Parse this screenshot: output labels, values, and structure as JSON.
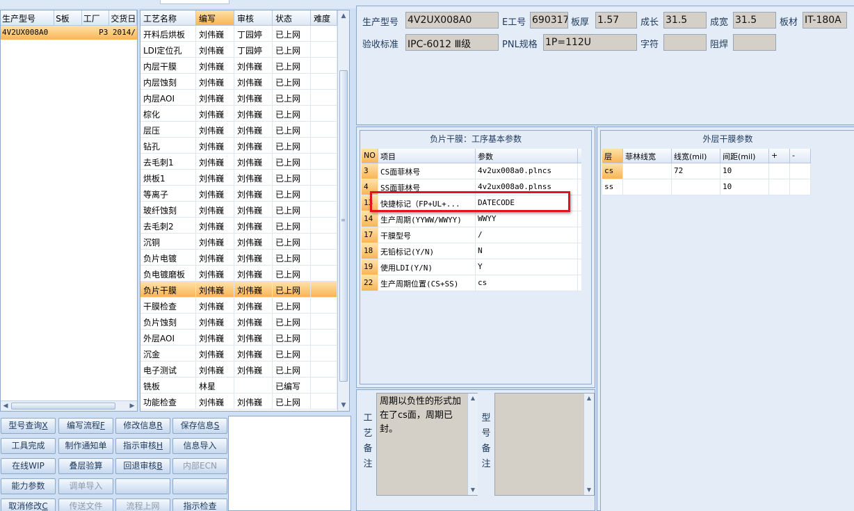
{
  "model_list": {
    "columns": [
      "生产型号",
      "S板",
      "工厂",
      "交货日"
    ],
    "selected_row": {
      "model": "4V2UX008A0",
      "s_board": "",
      "factory": "P3",
      "delivery": "2014/"
    }
  },
  "process_list": {
    "columns": [
      "工艺名称",
      "编写",
      "审核",
      "状态",
      "难度"
    ],
    "rows": [
      {
        "name": "开料后烘板",
        "writer": "刘伟巍",
        "reviewer": "丁园婷",
        "status": "已上网"
      },
      {
        "name": "LDI定位孔",
        "writer": "刘伟巍",
        "reviewer": "丁园婷",
        "status": "已上网"
      },
      {
        "name": "内层干膜",
        "writer": "刘伟巍",
        "reviewer": "刘伟巍",
        "status": "已上网"
      },
      {
        "name": "内层蚀刻",
        "writer": "刘伟巍",
        "reviewer": "刘伟巍",
        "status": "已上网"
      },
      {
        "name": "内层AOI",
        "writer": "刘伟巍",
        "reviewer": "刘伟巍",
        "status": "已上网"
      },
      {
        "name": "棕化",
        "writer": "刘伟巍",
        "reviewer": "刘伟巍",
        "status": "已上网"
      },
      {
        "name": "层压",
        "writer": "刘伟巍",
        "reviewer": "刘伟巍",
        "status": "已上网"
      },
      {
        "name": "钻孔",
        "writer": "刘伟巍",
        "reviewer": "刘伟巍",
        "status": "已上网"
      },
      {
        "name": "去毛刺1",
        "writer": "刘伟巍",
        "reviewer": "刘伟巍",
        "status": "已上网"
      },
      {
        "name": "烘板1",
        "writer": "刘伟巍",
        "reviewer": "刘伟巍",
        "status": "已上网"
      },
      {
        "name": "等离子",
        "writer": "刘伟巍",
        "reviewer": "刘伟巍",
        "status": "已上网"
      },
      {
        "name": "玻纤蚀刻",
        "writer": "刘伟巍",
        "reviewer": "刘伟巍",
        "status": "已上网"
      },
      {
        "name": "去毛刺2",
        "writer": "刘伟巍",
        "reviewer": "刘伟巍",
        "status": "已上网"
      },
      {
        "name": "沉铜",
        "writer": "刘伟巍",
        "reviewer": "刘伟巍",
        "status": "已上网"
      },
      {
        "name": "负片电镀",
        "writer": "刘伟巍",
        "reviewer": "刘伟巍",
        "status": "已上网"
      },
      {
        "name": "负电镀磨板",
        "writer": "刘伟巍",
        "reviewer": "刘伟巍",
        "status": "已上网"
      },
      {
        "name": "负片干膜",
        "writer": "刘伟巍",
        "reviewer": "刘伟巍",
        "status": "已上网"
      },
      {
        "name": "干膜检查",
        "writer": "刘伟巍",
        "reviewer": "刘伟巍",
        "status": "已上网"
      },
      {
        "name": "负片蚀刻",
        "writer": "刘伟巍",
        "reviewer": "刘伟巍",
        "status": "已上网"
      },
      {
        "name": "外层AOI",
        "writer": "刘伟巍",
        "reviewer": "刘伟巍",
        "status": "已上网"
      },
      {
        "name": "沉金",
        "writer": "刘伟巍",
        "reviewer": "刘伟巍",
        "status": "已上网"
      },
      {
        "name": "电子测试",
        "writer": "刘伟巍",
        "reviewer": "刘伟巍",
        "status": "已上网"
      },
      {
        "name": "铣板",
        "writer": "林星",
        "reviewer": "",
        "status": "已编写"
      },
      {
        "name": "功能检查",
        "writer": "刘伟巍",
        "reviewer": "刘伟巍",
        "status": "已上网"
      }
    ],
    "active_index": 16
  },
  "buttons": {
    "model_query": "型号查询",
    "model_query_key": "X",
    "write_flow": "编写流程",
    "write_flow_key": "F",
    "modify_info": "修改信息",
    "modify_info_key": "R",
    "save_info": "保存信息",
    "save_info_key": "S",
    "tool_done": "工具完成",
    "make_notice": "制作通知单",
    "indicate_review": "指示审核",
    "indicate_review_key": "H",
    "info_import": "信息导入",
    "online_wip": "在线WIP",
    "stack_calc": "叠层验算",
    "return_review": "回退审核",
    "return_review_key": "B",
    "internal_ecn": "内部ECN",
    "capability_params": "能力参数",
    "adjust_import": "调单导入",
    "cancel_modify": "取消修改",
    "cancel_modify_key": "C",
    "send_file": "传送文件",
    "flow_online": "流程上网",
    "indicate_check": "指示检查"
  },
  "info": {
    "model_label": "生产型号",
    "model_value": "4V2UX008A0",
    "e_no_label": "E工号",
    "e_no_value": "690317",
    "thickness_label": "板厚",
    "thickness_value": "1.57",
    "length_label": "成长",
    "length_value": "31.5",
    "width_label": "成宽",
    "width_value": "31.5",
    "material_label": "板材",
    "material_value": "IT-180A",
    "standard_label": "验收标准",
    "standard_value": "IPC-6012 Ⅲ级",
    "pnl_label": "PNL规格",
    "pnl_value": "1P=112U",
    "char_label": "字符",
    "char_value": "",
    "solder_label": "阻焊",
    "solder_value": ""
  },
  "basic_params": {
    "title": "负片干膜：工序基本参数",
    "columns": [
      "NO",
      "项目",
      "参数"
    ],
    "rows": [
      {
        "no": "3",
        "item": "CS面菲林号",
        "value": "4v2ux008a0.plncs"
      },
      {
        "no": "4",
        "item": "SS面菲林号",
        "value": "4v2ux008a0.plnss"
      },
      {
        "no": "13",
        "item": "快捷标记（FP+UL+...",
        "value": "DATECODE"
      },
      {
        "no": "14",
        "item": "生产周期(YYWW/WWYY)",
        "value": "WWYY"
      },
      {
        "no": "17",
        "item": "干膜型号",
        "value": "/"
      },
      {
        "no": "18",
        "item": "无铅标记(Y/N)",
        "value": "N"
      },
      {
        "no": "19",
        "item": "使用LDI(Y/N)",
        "value": "Y"
      },
      {
        "no": "22",
        "item": "生产周期位置(CS+SS)",
        "value": "cs"
      }
    ]
  },
  "outer_params": {
    "title": "外层干膜参数",
    "columns": [
      "层",
      "菲林线宽",
      "线宽(mil)",
      "间距(mil)",
      "+",
      "-"
    ],
    "rows": [
      {
        "layer": "cs",
        "film_width": "",
        "line_width": "72",
        "spacing": "10"
      },
      {
        "layer": "ss",
        "film_width": "",
        "line_width": "",
        "spacing": "10"
      }
    ]
  },
  "remarks": {
    "process_label": "工艺备注",
    "process_text": "周期以负性的形式加在了cs面，周期已封。",
    "model_label": "型号备注",
    "model_text": ""
  },
  "colors": {
    "selection": "#f8b555",
    "highlight_border": "#e0141e",
    "background": "#cfe0f4"
  }
}
